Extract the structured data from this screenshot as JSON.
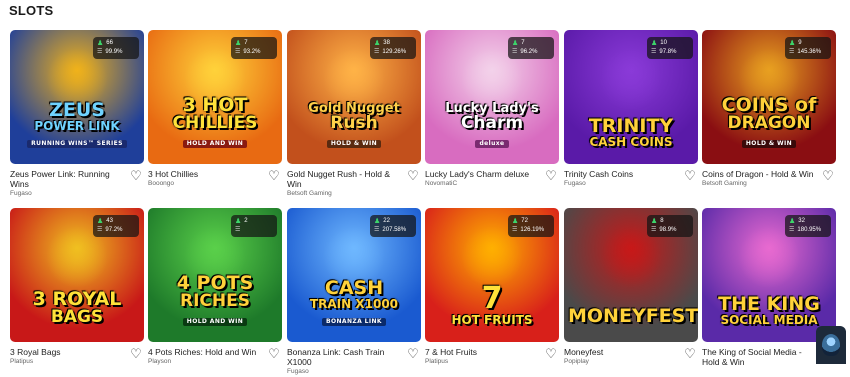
{
  "section": {
    "title": "SLOTS"
  },
  "games": [
    {
      "name": "Zeus Power Link: Running Wins",
      "provider": "Fugaso",
      "players": "66",
      "rtp": "99.9%",
      "logo_line1": "ZEUS",
      "logo_line2": "POWER LINK",
      "logo_tag": "RUNNING WINS™ SERIES",
      "bg": "#1f3f9a",
      "bg2": "#f0b21a",
      "logo_color": "#6fd3ff",
      "tag_bg": "#1a2a6e"
    },
    {
      "name": "3 Hot Chillies",
      "provider": "Booongo",
      "players": "7",
      "rtp": "93.2%",
      "logo_line1": "3 HOT",
      "logo_line2": "CHILLIES",
      "logo_tag": "HOLD AND WIN",
      "bg": "#e86a12",
      "bg2": "#ffd23a",
      "logo_color": "#ffe23a",
      "tag_bg": "#8a1a10"
    },
    {
      "name": "Gold Nugget Rush - Hold & Win",
      "provider": "Betsoft Gaming",
      "players": "38",
      "rtp": "129.26%",
      "logo_line1": "Gold Nugget",
      "logo_line2": "Rush",
      "logo_tag": "HOLD & WIN",
      "bg": "#c2501c",
      "bg2": "#ffb347",
      "logo_color": "#ffd24a",
      "tag_bg": "#5a2a10"
    },
    {
      "name": "Lucky Lady's Charm deluxe",
      "provider": "NovomatiC",
      "players": "7",
      "rtp": "96.2%",
      "logo_line1": "Lucky Lady's",
      "logo_line2": "Charm",
      "logo_tag": "deluxe",
      "bg": "#d86cc0",
      "bg2": "#f3d2ea",
      "logo_color": "#ffffff",
      "tag_bg": "#7a2a70"
    },
    {
      "name": "Trinity Cash Coins",
      "provider": "Fugaso",
      "players": "10",
      "rtp": "97.8%",
      "logo_line1": "TRINITY",
      "logo_line2": "CASH COINS",
      "logo_tag": "",
      "bg": "#5a1aa8",
      "bg2": "#8a3ad8",
      "logo_color": "#ffd23a",
      "tag_bg": "#2a0a5a"
    },
    {
      "name": "Coins of Dragon - Hold & Win",
      "provider": "Betsoft Gaming",
      "players": "9",
      "rtp": "145.36%",
      "logo_line1": "COINS of",
      "logo_line2": "DRAGON",
      "logo_tag": "HOLD & WIN",
      "bg": "#8a0e12",
      "bg2": "#e8a020",
      "logo_color": "#ffd23a",
      "tag_bg": "#3a0a0a"
    },
    {
      "name": "3 Royal Bags",
      "provider": "Platipus",
      "players": "43",
      "rtp": "97.2%",
      "logo_line1": "3 ROYAL",
      "logo_line2": "BAGS",
      "logo_tag": "",
      "bg": "#c81818",
      "bg2": "#f0c020",
      "logo_color": "#ffe23a",
      "tag_bg": "#5a0a0a"
    },
    {
      "name": "4 Pots Riches: Hold and Win",
      "provider": "Playson",
      "players": "2",
      "rtp": "",
      "logo_line1": "4 POTS",
      "logo_line2": "RICHES",
      "logo_tag": "HOLD AND WIN",
      "bg": "#1e7a2a",
      "bg2": "#5ad04a",
      "logo_color": "#ffd23a",
      "tag_bg": "#0a3a12"
    },
    {
      "name": "Bonanza Link: Cash Train X1000",
      "provider": "Fugaso",
      "players": "22",
      "rtp": "207.58%",
      "logo_line1": "CASH",
      "logo_line2": "TRAIN X1000",
      "logo_tag": "BONANZA LINK",
      "bg": "#1a5ad0",
      "bg2": "#6fb8ff",
      "logo_color": "#ffd23a",
      "tag_bg": "#0a2a6a"
    },
    {
      "name": "7 & Hot Fruits",
      "provider": "Platipus",
      "players": "72",
      "rtp": "126.19%",
      "logo_line1": "7",
      "logo_line2": "HOT FRUITS",
      "logo_tag": "",
      "bg": "#d8201a",
      "bg2": "#ffb000",
      "logo_color": "#ffe23a",
      "tag_bg": "#5a0a0a"
    },
    {
      "name": "Moneyfest",
      "provider": "Popiplay",
      "players": "8",
      "rtp": "98.9%",
      "logo_line1": "MONEYFEST",
      "logo_line2": "",
      "logo_tag": "",
      "bg": "#4a4a4a",
      "bg2": "#c81818",
      "logo_color": "#ffd23a",
      "tag_bg": "#222222"
    },
    {
      "name": "The King of Social Media - Hold & Win",
      "provider": "",
      "players": "32",
      "rtp": "180.95%",
      "logo_line1": "THE KING",
      "logo_line2": "SOCIAL MEDIA",
      "logo_tag": "",
      "bg": "#5a2aa8",
      "bg2": "#e86ad0",
      "logo_color": "#ffd23a",
      "tag_bg": "#2a0a5a"
    }
  ],
  "icons": {
    "heart": "heart-outline-icon",
    "players": "people-icon",
    "rtp": "coin-stack-icon"
  }
}
